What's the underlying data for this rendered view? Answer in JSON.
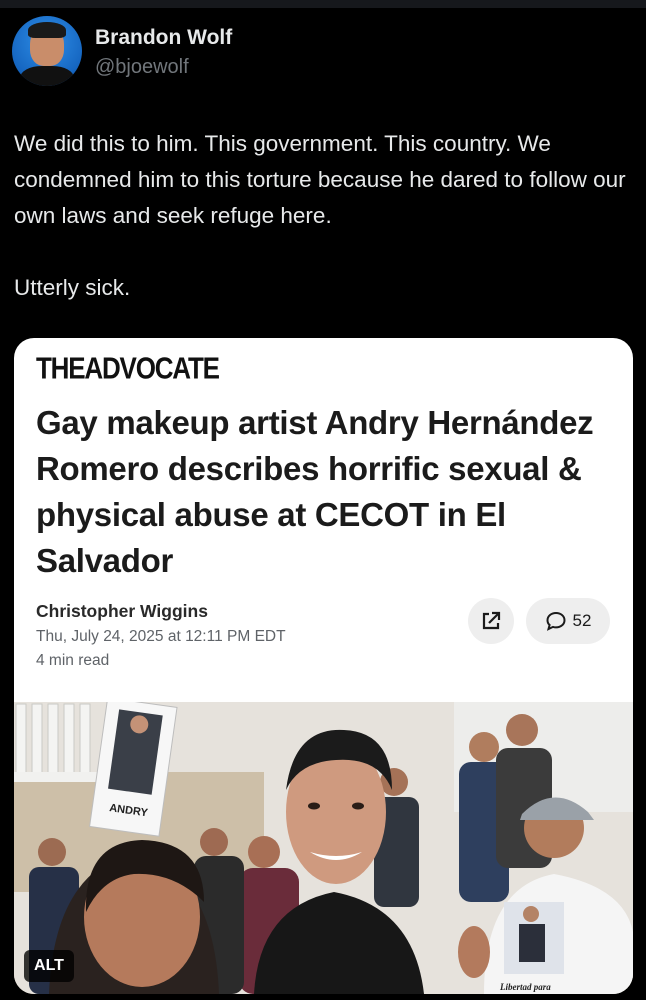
{
  "post": {
    "author_name": "Brandon Wolf",
    "author_handle": "@bjoewolf",
    "text": "We did this to him. This government. This country. We condemned him to this torture because he dared to follow our own laws and seek refuge here.\n\nUtterly sick."
  },
  "card": {
    "publication": "THEADVOCATE",
    "headline": "Gay makeup artist Andry Hernández Romero describes horrific sexual & physical abuse at CECOT in El Salvador",
    "author": "Christopher Wiggins",
    "date": "Thu, July 24, 2025 at 12:11 PM EDT",
    "read_time": "4 min read",
    "comment_count": "52",
    "share_icon": "share-external-icon",
    "comment_icon": "speech-bubble-icon"
  },
  "photo": {
    "sign_text": "ANDRY",
    "shirt_text": "Libertad para",
    "alt_label": "ALT"
  },
  "colors": {
    "background": "#000000",
    "text_primary": "#e7e9ea",
    "text_secondary": "#71767b",
    "card_bg": "#ffffff",
    "headline": "#1b1b1b"
  }
}
